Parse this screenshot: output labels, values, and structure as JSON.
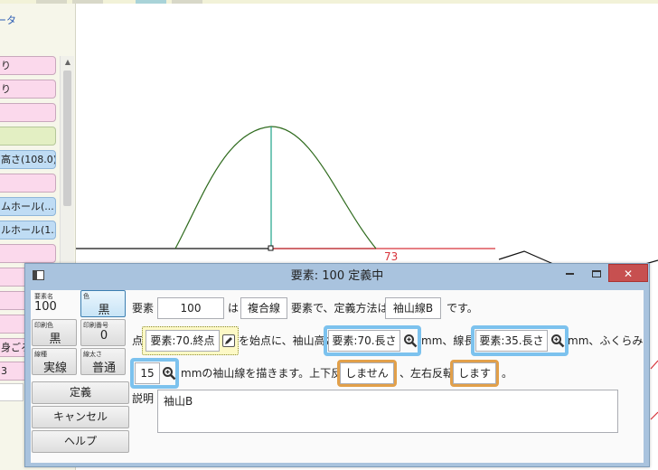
{
  "left_panel": {
    "data_link": "ータ",
    "items": [
      {
        "label": "り",
        "style": "pink"
      },
      {
        "label": "り",
        "style": "pink"
      },
      {
        "label": "",
        "style": "pink"
      },
      {
        "label": "",
        "style": "green"
      },
      {
        "label": "高さ(108.0)",
        "style": "blue"
      },
      {
        "label": "",
        "style": "pink"
      },
      {
        "label": "ムホール(...",
        "style": "blue"
      },
      {
        "label": "ルホール(1...",
        "style": "blue"
      },
      {
        "label": "",
        "style": "pink"
      },
      {
        "label": "",
        "style": "pink"
      },
      {
        "label": "",
        "style": "pink"
      },
      {
        "label": "",
        "style": "pink"
      },
      {
        "label": "身ごろ",
        "style": "pink"
      },
      {
        "label": "3",
        "style": "pink"
      }
    ]
  },
  "canvas": {
    "dimension_label": "73",
    "colors": {
      "curve": "#2f6b1e",
      "vertical": "#1fa38a",
      "dimension": "#d8343b",
      "baseline": "#111111"
    }
  },
  "dialog": {
    "title": "要素: 100 定義中",
    "titlebar_buttons": {
      "close": "✕"
    },
    "tiles": {
      "name": {
        "label": "要素名",
        "value": "100"
      },
      "color": {
        "label": "色",
        "value": "黒"
      },
      "print_color": {
        "label": "印刷色",
        "value": "黒"
      },
      "print_number": {
        "label": "印刷番号",
        "value": "0"
      },
      "line_type": {
        "label": "線種",
        "value": "実線"
      },
      "line_width": {
        "label": "線太さ",
        "value": "普通"
      }
    },
    "buttons": {
      "define": "定義",
      "cancel": "キャンセル",
      "help": "ヘルプ"
    },
    "row1": {
      "lead": "要素",
      "element": "100",
      "is": "は",
      "kind": "複合線",
      "mid": "要素で、定義方法は",
      "method": "袖山線B",
      "end": "です。"
    },
    "row2": {
      "lead": "点",
      "point": "要素:70.終点",
      "text1": "を始点に、袖山高さ",
      "height": "要素:70.長さ",
      "text2": "mm、線長",
      "length": "要素:35.長さ",
      "text3": "mm、ふくらみ"
    },
    "row3": {
      "bulge": "15",
      "text1": "mmの袖山線を描きます。上下反転",
      "flip_v": "しません",
      "text2": "、左右反転",
      "flip_h": "します",
      "end": "。"
    },
    "description": {
      "label": "説明",
      "value": "袖山B"
    }
  }
}
